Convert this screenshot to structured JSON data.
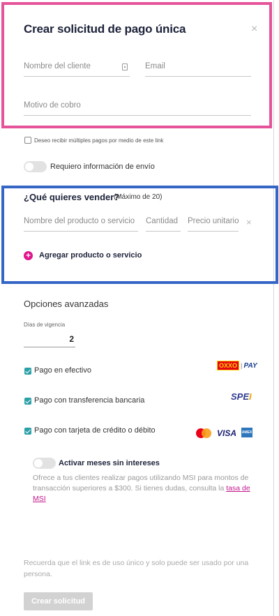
{
  "modal": {
    "title": "Crear solicitud de pago única",
    "close_icon": "×"
  },
  "client": {
    "name_placeholder": "Nombre del cliente",
    "email_placeholder": "Email",
    "reason_placeholder": "Motivo de cobro"
  },
  "multiple_payments": {
    "label": "Deseo recibir múltiples pagos por medio de este link",
    "checked": false
  },
  "shipping": {
    "label": "Requiero información de envío",
    "enabled": false
  },
  "products": {
    "heading": "¿Qué quieres vender?",
    "max_note": "(Máximo de 20)",
    "name_placeholder": "Nombre del producto o servicio",
    "quantity_placeholder": "Cantidad",
    "price_placeholder": "Precio unitario",
    "remove_icon": "×",
    "add_label": "Agregar producto o servicio",
    "add_icon": "+"
  },
  "advanced": {
    "heading": "Opciones avanzadas",
    "days_label": "Días de vigencia",
    "days_value": "2"
  },
  "payment_methods": [
    {
      "label": "Pago en efectivo",
      "checked": true,
      "logo": "oxxo-pay"
    },
    {
      "label": "Pago con transferencia bancaria",
      "checked": true,
      "logo": "spei"
    },
    {
      "label": "Pago con tarjeta de crédito o débito",
      "checked": true,
      "logo": "cards"
    }
  ],
  "logos": {
    "oxxo": "OXXO",
    "pay": "PAY",
    "spei_main": "SPE",
    "spei_accent": "I",
    "visa": "VISA",
    "amex": "AMEX"
  },
  "msi": {
    "toggle_label": "Activar meses sin intereses",
    "enabled": false,
    "description": "Ofrece a tus clientes realizar pagos utilizando MSI para montos de transacción superiores a $300. Si tienes dudas, consulta la",
    "link_text": "tasa de MSI"
  },
  "footer": {
    "note": "Recuerda que el link es de uso único y solo puede ser usado por una persona.",
    "submit_label": "Crear solicitud"
  },
  "colors": {
    "accent": "#e0148c",
    "checkbox": "#2aa0a8",
    "highlight_pink": "#e5539a",
    "highlight_blue": "#3566c6"
  }
}
